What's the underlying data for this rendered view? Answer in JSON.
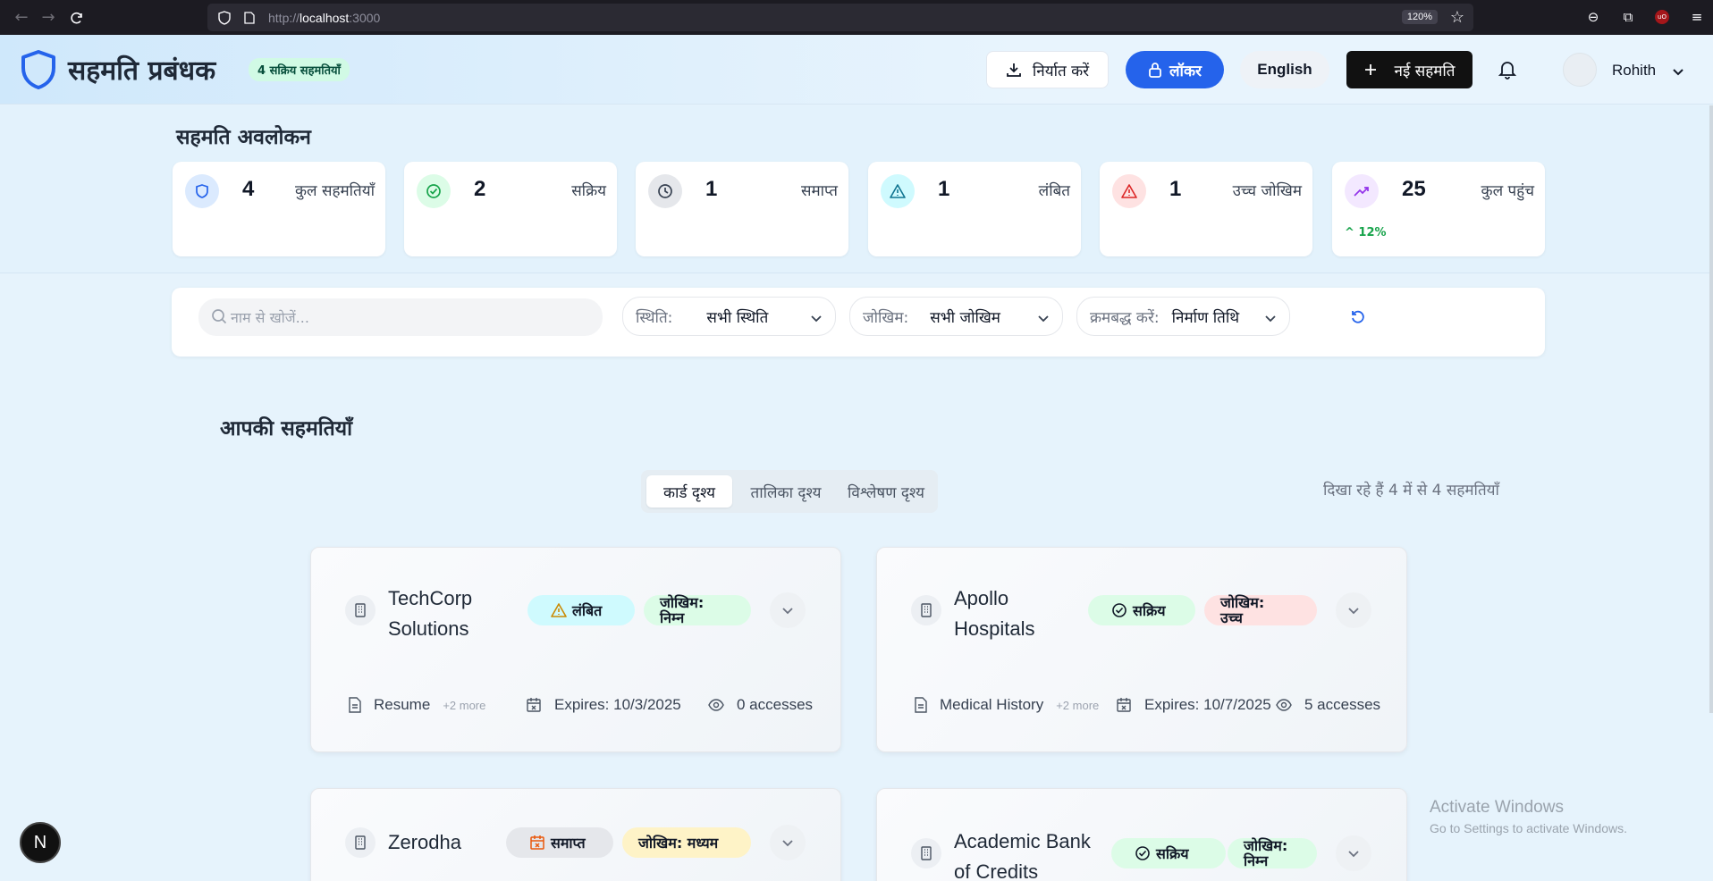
{
  "browser": {
    "url_prefix": "http://",
    "url_host": "localhost",
    "url_port": ":3000",
    "zoom": "120%"
  },
  "header": {
    "app_title": "सहमति प्रबंधक",
    "active_badge": "4 सक्रिय सहमतियाँ",
    "export_label": "निर्यात करें",
    "locker_label": "लॉकर",
    "language_label": "English",
    "new_consent_label": "नई सहमति",
    "user_name": "Rohith",
    "brand_color": "#2563eb"
  },
  "overview": {
    "title": "सहमति अवलोकन",
    "stats": [
      {
        "value": "4",
        "label": "कुल सहमतियाँ",
        "icon": "shield-icon"
      },
      {
        "value": "2",
        "label": "सक्रिय",
        "icon": "check-circle-icon"
      },
      {
        "value": "1",
        "label": "समाप्त",
        "icon": "clock-icon"
      },
      {
        "value": "1",
        "label": "लंबित",
        "icon": "warning-triangle-icon"
      },
      {
        "value": "1",
        "label": "उच्च जोखिम",
        "icon": "alert-triangle-icon"
      },
      {
        "value": "25",
        "label": "कुल पहुंच",
        "icon": "trending-up-icon",
        "trend": "12%"
      }
    ]
  },
  "filters": {
    "search_placeholder": "नाम से खोजें...",
    "status_label": "स्थिति:",
    "status_value": "सभी स्थिति",
    "risk_label": "जोखिम:",
    "risk_value": "सभी जोखिम",
    "sort_label": "क्रमबद्ध करें:",
    "sort_value": "निर्माण तिथि"
  },
  "consents": {
    "title": "आपकी सहमतियाँ",
    "tabs": [
      "कार्ड दृश्य",
      "तालिका दृश्य",
      "विश्लेषण दृश्य"
    ],
    "active_tab": "कार्ड दृश्य",
    "showing_text": "दिखा रहे हैं 4 में से 4 सहमतियाँ",
    "cards": [
      {
        "name_line1": "TechCorp",
        "name_line2": "Solutions",
        "status": "लंबित",
        "risk_line1": "जोखिम:",
        "risk_line2": "निम्न",
        "data_item": "Resume",
        "more": "+2 more",
        "expires": "Expires: 10/3/2025",
        "accesses": "0 accesses"
      },
      {
        "name_line1": "Apollo",
        "name_line2": "Hospitals",
        "status": "सक्रिय",
        "risk_line1": "जोखिम:",
        "risk_line2": "उच्च",
        "data_item": "Medical History",
        "more": "+2 more",
        "expires": "Expires: 10/7/2025",
        "accesses": "5 accesses"
      },
      {
        "name_line1": "Zerodha",
        "status": "समाप्त",
        "risk_line1": "जोखिम: मध्यम"
      },
      {
        "name_line1": "Academic Bank",
        "name_line2": "of Credits",
        "status": "सक्रिय",
        "risk_line1": "जोखिम:",
        "risk_line2": "निम्न"
      }
    ]
  },
  "watermark": {
    "line1": "Activate Windows",
    "line2": "Go to Settings to activate Windows."
  },
  "dev_badge": "N"
}
